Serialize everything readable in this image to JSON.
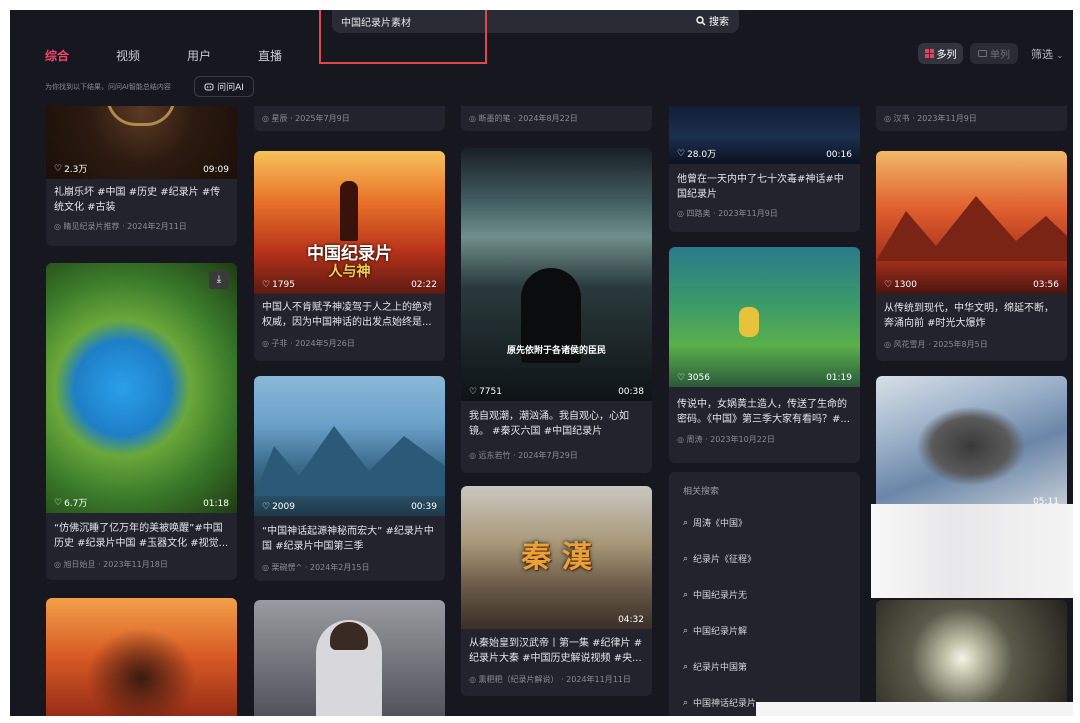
{
  "search": {
    "query": "中国纪录片素材",
    "button": "搜索"
  },
  "tabs": [
    "综合",
    "视频",
    "用户",
    "直播"
  ],
  "view": {
    "multi": "多列",
    "single": "单列",
    "filter": "筛选"
  },
  "hint": "为你找到以下结果，问问AI智能总结内容",
  "ask_ai": "问问AI",
  "cards": [
    {
      "meta": "星辰 · 2025年7月9日"
    },
    {
      "meta": "断墨的笔 · 2024年8月22日"
    },
    {
      "meta": "汉书 · 2023年11月9日"
    },
    {
      "likes": "2.3万",
      "duration": "09:09",
      "title": "礼崩乐坏 #中国 #历史 #纪录片 #传统文化 #古装",
      "author": "睛见纪录片推荐",
      "date": "2024年2月11日"
    },
    {
      "likes": "28.0万",
      "duration": "00:16",
      "title": "他曾在一天内中了七十次毒#神话#中国纪录片",
      "author": "四路奥",
      "date": "2023年11月9日"
    },
    {
      "likes": "1795",
      "duration": "02:22",
      "overlay1": "中国纪录片",
      "overlay2": "人与神",
      "title": "中国人不肯赋予神凌驾于人之上的绝对权威，因为中国神话的出发点始终是...",
      "author": "子非",
      "date": "2024年5月26日"
    },
    {
      "likes": "7751",
      "duration": "00:38",
      "overlay": "原先依附于各诸侯的臣民",
      "title": "我自观潮，潮汹涌。我自观心，心如镜。 #秦灭六国 #中国纪录片",
      "author": "远东若竹",
      "date": "2024年7月29日"
    },
    {
      "likes": "1300",
      "duration": "03:56",
      "title": "从传统到现代，中华文明，绵延不断，奔涌向前 #时光大爆炸",
      "author": "风花雪月",
      "date": "2025年8月5日"
    },
    {
      "likes": "6.7万",
      "duration": "01:18",
      "title": "“仿佛沉睡了亿万年的美被唤醒”#中国历史 #纪录片中国 #玉器文化 #视觉...",
      "author": "旭日始旦",
      "date": "2023年11月18日"
    },
    {
      "likes": "3056",
      "duration": "01:19",
      "title": "传说中，女娲黄土造人，传送了生命的密码。《中国》第三季大家有看吗？#...",
      "author": "周涛",
      "date": "2023年10月22日"
    },
    {
      "likes": "2009",
      "duration": "00:39",
      "title": "“中国神话起源神秘而宏大” #纪录片中国 #纪录片中国第三季",
      "author": "栗碗愣^",
      "date": "2024年2月15日"
    },
    {
      "duration": "05:11"
    },
    {
      "duration": "04:32",
      "overlay": "秦 漢",
      "title": "从秦始皇到汉武帝丨第一集 #纪律片 #纪录片大秦 #中国历史解说视频 #央...",
      "author": "熏粑粑（纪录片解说）",
      "date": "2024年11月11日"
    }
  ],
  "related": {
    "title": "相关搜索",
    "items": [
      "周涛《中国》",
      "纪录片《征程》",
      "中国纪录片无",
      "中国纪录片解",
      "纪录片中国第",
      "中国神话纪录片"
    ]
  }
}
